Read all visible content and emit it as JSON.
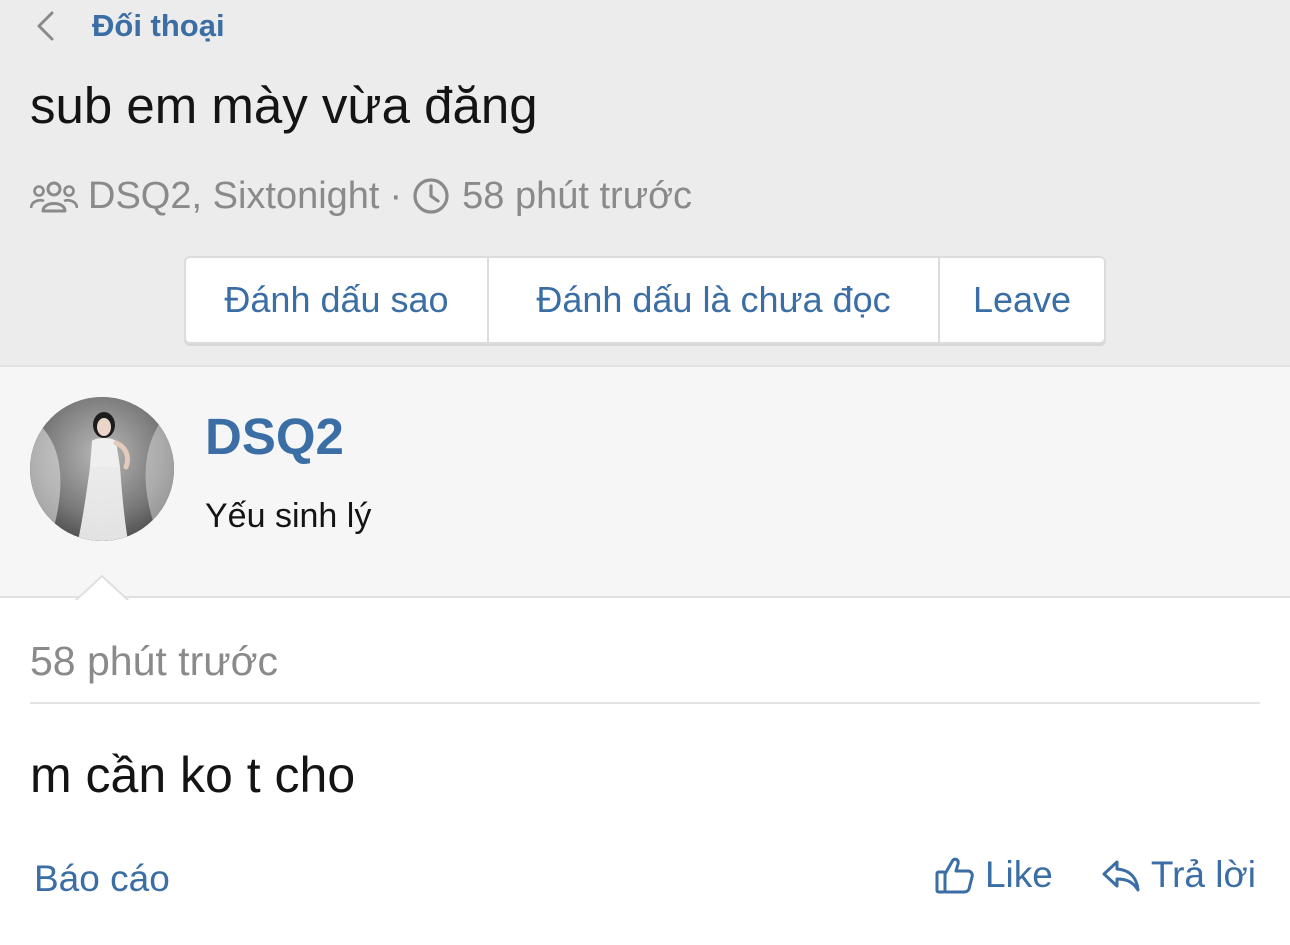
{
  "breadcrumb": {
    "label": "Đối thoại"
  },
  "conversation": {
    "title": "sub em mày vừa đăng",
    "participants": "DSQ2, Sixtonight",
    "separator": "·",
    "time": "58 phút trước"
  },
  "buttons": {
    "star": "Đánh dấu sao",
    "unread": "Đánh dấu là chưa đọc",
    "leave": "Leave"
  },
  "author": {
    "name": "DSQ2",
    "title": "Yếu sinh lý"
  },
  "message": {
    "time": "58 phút trước",
    "body": "m cần ko t cho"
  },
  "actions": {
    "report": "Báo cáo",
    "like": "Like",
    "reply": "Trả lời"
  },
  "colors": {
    "link": "#3a6ea5",
    "muted": "#8a8a8a",
    "header_bg": "#ececec"
  },
  "icons": [
    "chevron-left-icon",
    "users-icon",
    "clock-icon",
    "thumbs-up-icon",
    "reply-icon"
  ]
}
